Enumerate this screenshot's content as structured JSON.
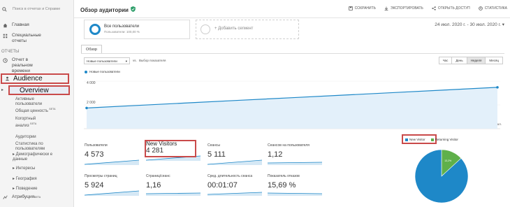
{
  "colors": {
    "accent": "#1e88c8",
    "highlight": "#c94a4a",
    "pie_new": "#1e88c8",
    "pie_returning": "#5fb04a"
  },
  "sidebar": {
    "search_placeholder": "Поиск в отчетах и Справке",
    "home": "Главная",
    "custom_reports": "Специальные отчеты",
    "reports_section": "ОТЧЕТЫ",
    "realtime": "Отчет в реальном времени",
    "audience": "Audience",
    "overview": "Overview",
    "sub_items": [
      {
        "label": "Активные пользователи"
      },
      {
        "label": "Общая ценность",
        "sup": "БЕТА"
      },
      {
        "label": "Когортный анализ",
        "sup": "БЕТА"
      },
      {
        "label": "Аудитории"
      },
      {
        "label": "Статистика по пользователям"
      },
      {
        "label": "▸ Демографически е данные"
      },
      {
        "label": "▸ Интересы"
      },
      {
        "label": "▸ География"
      },
      {
        "label": "▸ Поведение"
      }
    ],
    "attribution": "Атрибуция",
    "attribution_badge": "БЕТА"
  },
  "header": {
    "title": "Обзор аудитории",
    "actions": [
      "СОХРАНИТЬ",
      "ЭКСПОРТИРОВАТЬ",
      "ОТКРЫТЬ ДОСТУП",
      "СТАТИСТИКА"
    ]
  },
  "segments": {
    "all_users": "Все пользователи",
    "all_users_sub": "Пользователи: 100,00 %",
    "add_segment": "+ Добавить сегмент"
  },
  "date_range": "24 июл. 2020 г. - 30 июл. 2020 г. ▾",
  "tabs": {
    "overview": "Обзор"
  },
  "controls": {
    "metric_select": "Новые пользователи",
    "vs": "vs.",
    "choose_metric": "Выбор показателя",
    "periods": [
      "Час",
      "День",
      "Неделя",
      "Месяц"
    ],
    "active_period": "Неделя"
  },
  "chart_data": {
    "type": "line",
    "series": [
      {
        "name": "Новые пользователи",
        "x": [
          "",
          "",
          "",
          "",
          "",
          "",
          "",
          "",
          ""
        ],
        "values": [
          2000,
          2250,
          2500,
          2750,
          3000,
          3250,
          3500,
          3750,
          4000
        ]
      }
    ],
    "ylabels": [
      "4 000",
      "2 000"
    ],
    "xlabels": [
      "25 июл.",
      "29 июл."
    ],
    "ylim": [
      0,
      4600
    ]
  },
  "metrics": [
    {
      "label": "Пользователи",
      "value": "4 573"
    },
    {
      "label": "New Visitors",
      "value": "4 281"
    },
    {
      "label": "Сеансы",
      "value": "5 111"
    },
    {
      "label": "Сеансов на пользователя",
      "value": "1,12"
    },
    {
      "label": "Просмотры страниц",
      "value": "5 924"
    },
    {
      "label": "Страниц/сеанс",
      "value": "1,16"
    },
    {
      "label": "Сред. длительность сеанса",
      "value": "00:01:07"
    },
    {
      "label": "Показатель отказов",
      "value": "15,69 %"
    }
  ],
  "pie": {
    "legend_new": "New Visitor",
    "legend_returning": "Returning Visitor",
    "new_pct": 86.8,
    "returning_pct": 13.2,
    "new_label": "86,8%",
    "returning_label": "13,2%"
  }
}
